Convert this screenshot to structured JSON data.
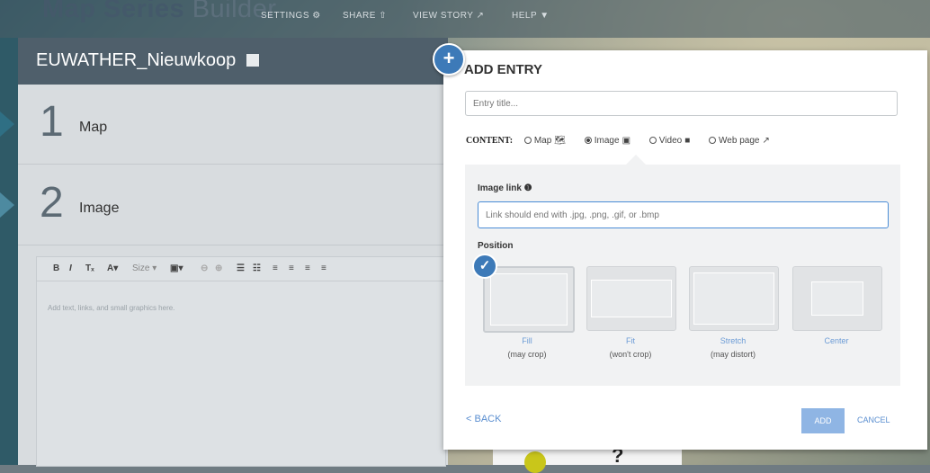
{
  "header": {
    "title_bold": "Map Series",
    "title_light": "Builder",
    "nav": [
      "SETTINGS ⚙",
      "SHARE ⇧",
      "VIEW STORY ↗",
      "HELP ▼"
    ]
  },
  "story": {
    "title": "EUWATHER_Nieuwkoop",
    "entries": [
      {
        "num": "1",
        "label": "Map"
      },
      {
        "num": "2",
        "label": "Image"
      }
    ],
    "editor_placeholder": "Add text, links, and small graphics here."
  },
  "toolbar": [
    "B",
    "I",
    "Tₓ",
    "A▾",
    "Size ▾",
    "▣▾",
    "⊖",
    "⊕",
    "☰",
    "☷",
    "≡",
    "≡",
    "≡",
    "≡"
  ],
  "dialog": {
    "title": "ADD ENTRY",
    "entry_title_placeholder": "Entry title...",
    "content_label": "CONTENT:",
    "options": [
      {
        "label": "Map",
        "icon": "🗺",
        "selected": false
      },
      {
        "label": "Image",
        "icon": "📷",
        "selected": true
      },
      {
        "label": "Video",
        "icon": "■",
        "selected": false
      },
      {
        "label": "Web page",
        "icon": "↗",
        "selected": false
      }
    ],
    "image_link_label": "Image link ❶",
    "image_link_placeholder": "Link should end with .jpg, .png, .gif, or .bmp",
    "position_label": "Position",
    "positions": [
      {
        "name": "Fill",
        "note": "(may crop)",
        "selected": true
      },
      {
        "name": "Fit",
        "note": "(won't crop)",
        "selected": false
      },
      {
        "name": "Stretch",
        "note": "(may distort)",
        "selected": false
      },
      {
        "name": "Center",
        "note": "",
        "selected": false
      }
    ],
    "back_label": "< BACK",
    "add_label": "ADD",
    "cancel_label": "CANCEL",
    "plus_icon": "+",
    "check_icon": "✓"
  },
  "colors": {
    "accent": "#3d7ab8",
    "link": "#5a8ed0",
    "panel_head": "#4f5f6b"
  }
}
